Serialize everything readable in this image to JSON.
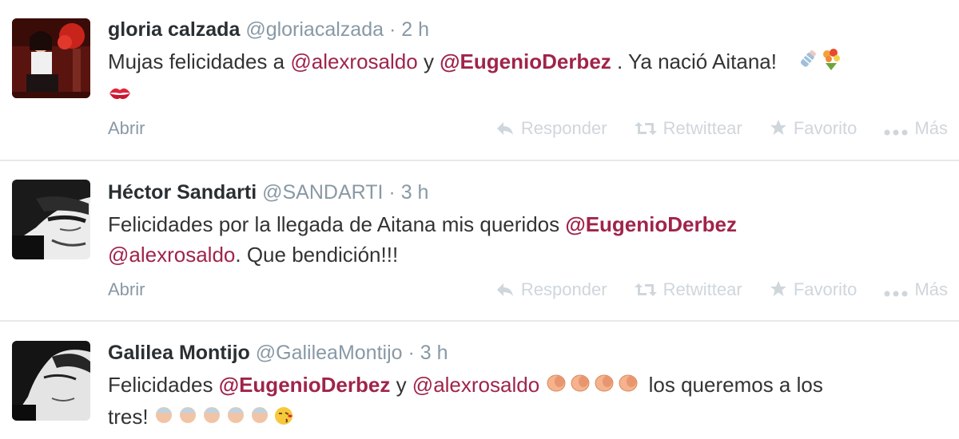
{
  "tweets": [
    {
      "name": "gloria calzada",
      "handle": "@gloriacalzada",
      "separator": "·",
      "time": "2 h",
      "text_1": "Mujas felicidades a ",
      "mention_1": "@alexrosaldo",
      "text_2": " y ",
      "mention_2": "@EugenioDerbez",
      "text_3": " . Ya nació Aitana!",
      "emojis": [
        "baby-bottle-icon",
        "bouquet-icon",
        "kiss-mark-icon"
      ]
    },
    {
      "name": "Héctor Sandarti",
      "handle": "@SANDARTI",
      "separator": "·",
      "time": "3 h",
      "text_1": "Felicidades por la llegada de Aitana mis queridos ",
      "mention_1": "@EugenioDerbez",
      "mention_2": "@alexrosaldo",
      "text_2": ". Que bendición!!!"
    },
    {
      "name": "Galilea Montijo",
      "handle": "@GalileaMontijo",
      "separator": "·",
      "time": "3 h",
      "text_1": "Felicidades ",
      "mention_1": "@EugenioDerbez",
      "text_2": " y ",
      "mention_2": "@alexrosaldo",
      "text_3": " los queremos a los",
      "text_4": "tres!",
      "emojis": [
        "clapping-hands-icon",
        "baby-icon",
        "face-blowing-kiss-icon"
      ]
    }
  ],
  "actions": {
    "open": "Abrir",
    "reply": "Responder",
    "retweet": "Retwittear",
    "favorite": "Favorito",
    "more": "Más"
  },
  "colors": {
    "mention": "#a0244a",
    "meta": "#8899a6",
    "action_faded": "#cfd6dc",
    "name": "#292f33"
  }
}
